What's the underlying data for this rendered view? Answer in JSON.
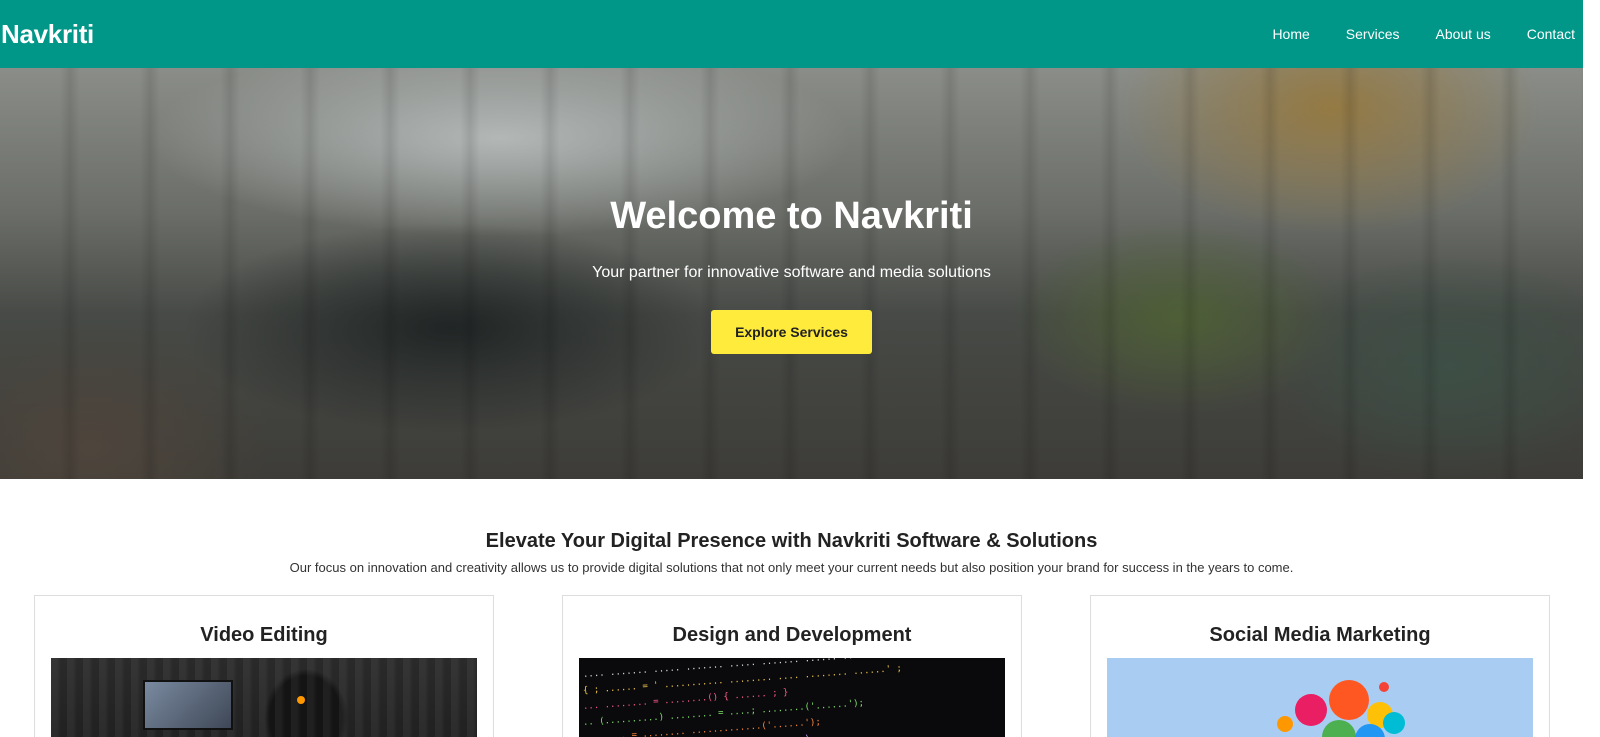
{
  "navbar": {
    "brand": "Navkriti",
    "links": [
      "Home",
      "Services",
      "About us",
      "Contact"
    ]
  },
  "hero": {
    "title": "Welcome to Navkriti",
    "subtitle": "Your partner for innovative software and media solutions",
    "button_label": "Explore Services"
  },
  "intro": {
    "title": "Elevate Your Digital Presence with Navkriti Software & Solutions",
    "text": "Our focus on innovation and creativity allows us to provide digital solutions that not only meet your current needs but also position your brand for success in the years to come."
  },
  "cards": [
    {
      "title": "Video Editing",
      "image": "video-editing-photo"
    },
    {
      "title": "Design and Development",
      "image": "code-screen-photo"
    },
    {
      "title": "Social Media Marketing",
      "image": "social-media-icons-illustration"
    }
  ],
  "colors": {
    "navbar": "#009688",
    "button": "#ffeb3b"
  }
}
